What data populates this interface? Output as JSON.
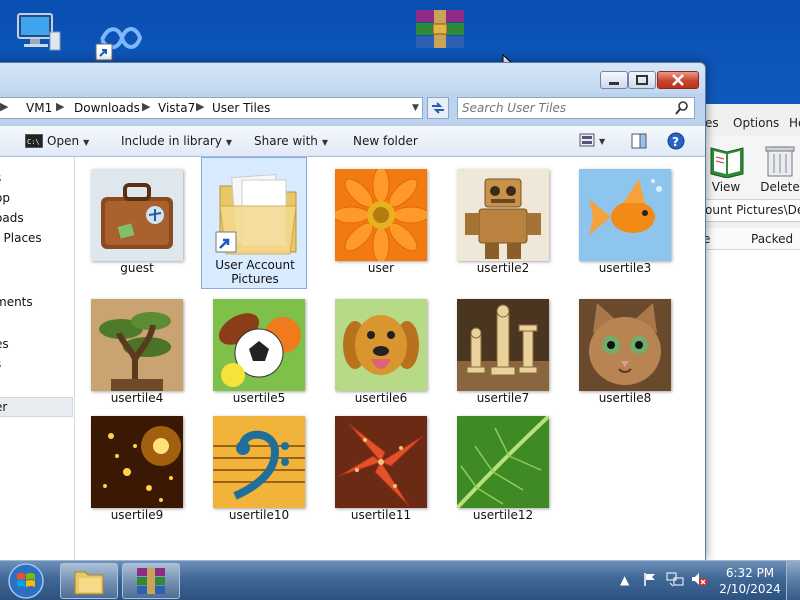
{
  "desktop": {
    "icons": [
      "computer-icon",
      "shortcut-icon",
      "winrar-icon"
    ]
  },
  "winrar": {
    "menu": [
      "es",
      "Options",
      "He"
    ],
    "tools": [
      {
        "label": "View",
        "icon": "view-book-icon"
      },
      {
        "label": "Delete",
        "icon": "trash-icon"
      }
    ],
    "path": "ount Pictures\\Defa",
    "headers": [
      "e",
      "Packed"
    ]
  },
  "explorer": {
    "breadcrumb": [
      "VM1",
      "Downloads",
      "Vista7",
      "User Tiles"
    ],
    "search": {
      "placeholder": "Search User Tiles"
    },
    "commands": {
      "open": "Open",
      "include": "Include in library",
      "share": "Share with",
      "new_folder": "New folder"
    },
    "nav_items": [
      "s",
      "op",
      "oads",
      "t Places",
      "ments",
      "es",
      "s",
      "er",
      "t"
    ],
    "items": [
      {
        "label": "guest",
        "icon": "suitcase-icon"
      },
      {
        "label": "User Account Pictures",
        "icon": "folder-icon"
      },
      {
        "label": "user",
        "icon": "flower-icon"
      },
      {
        "label": "usertile2",
        "icon": "robot-icon"
      },
      {
        "label": "usertile3",
        "icon": "goldfish-icon"
      },
      {
        "label": "usertile4",
        "icon": "bonsai-icon"
      },
      {
        "label": "usertile5",
        "icon": "sports-balls-icon"
      },
      {
        "label": "usertile6",
        "icon": "dog-icon"
      },
      {
        "label": "usertile7",
        "icon": "chess-icon"
      },
      {
        "label": "usertile8",
        "icon": "kitten-icon"
      },
      {
        "label": "usertile9",
        "icon": "sparkles-icon"
      },
      {
        "label": "usertile10",
        "icon": "music-clef-icon"
      },
      {
        "label": "usertile11",
        "icon": "starfish-icon"
      },
      {
        "label": "usertile12",
        "icon": "leaf-icon"
      }
    ]
  },
  "taskbar": {
    "clock": {
      "time": "6:32 PM",
      "date": "2/10/2024"
    },
    "colors": {
      "accent": "#3f6796",
      "selection": "#d9ebff"
    }
  }
}
